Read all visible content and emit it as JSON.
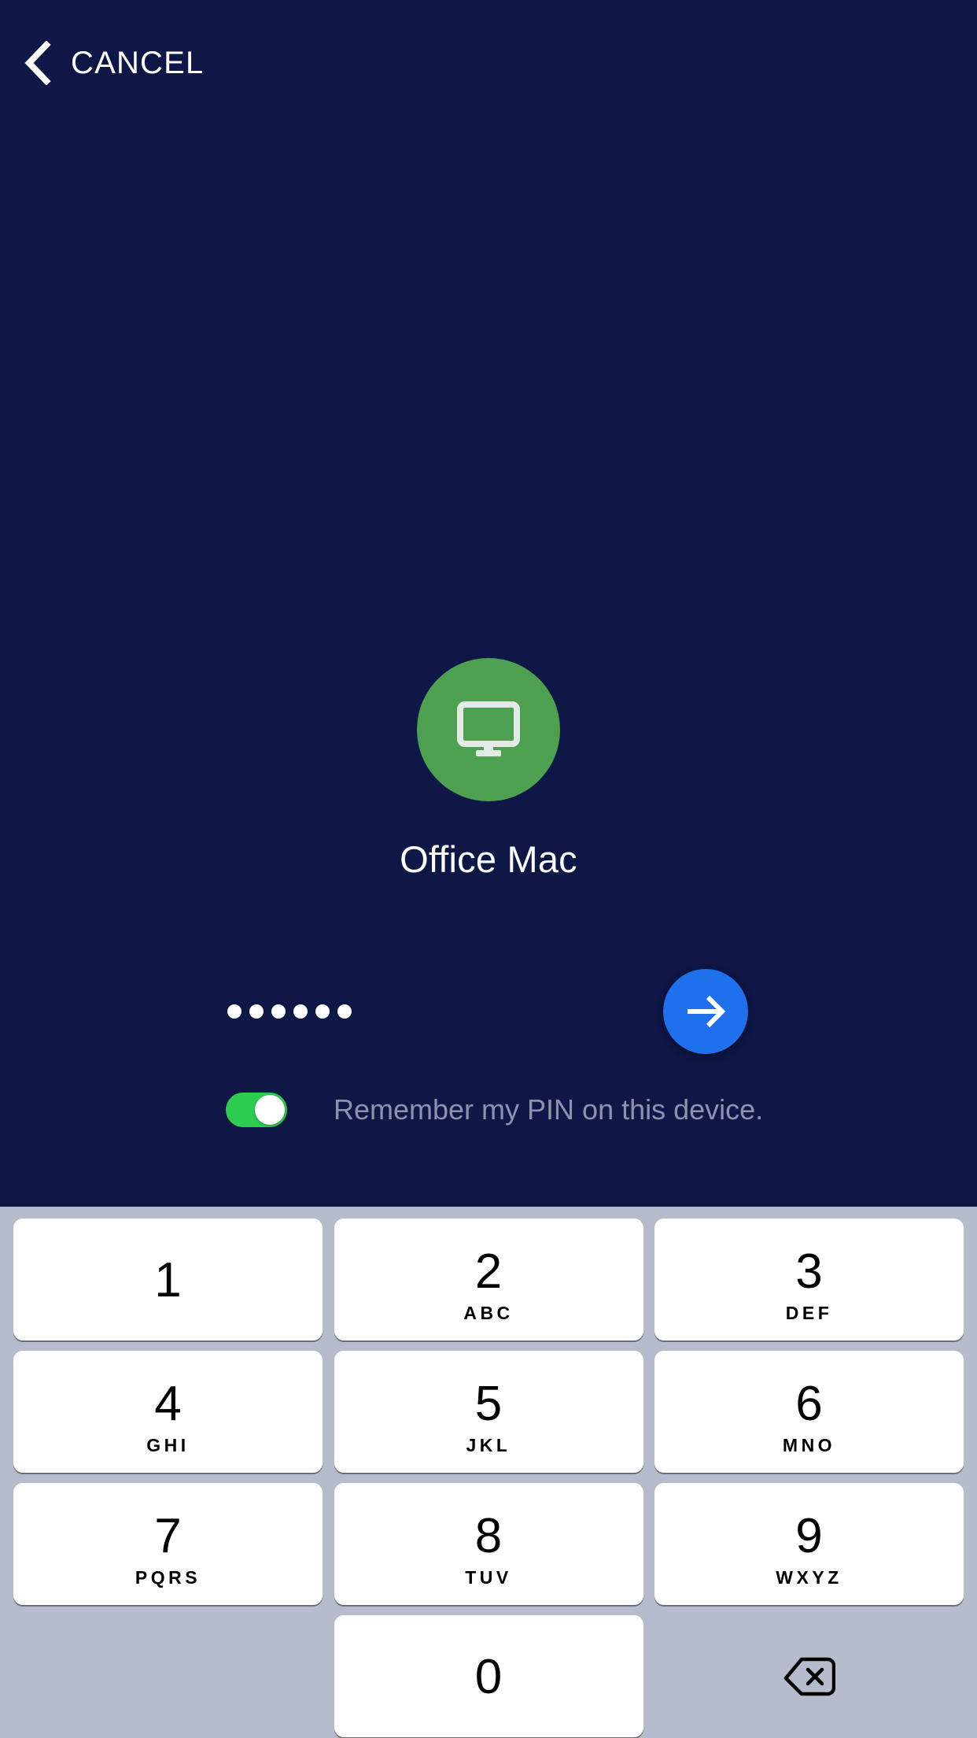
{
  "header": {
    "back_icon": "chevron-left-icon",
    "cancel_label": "CANCEL"
  },
  "device": {
    "avatar_icon": "monitor-icon",
    "avatar_color": "#4CA050",
    "name": "Office Mac"
  },
  "pin_entry": {
    "dots_filled": 6,
    "dot_color": "#FFFFFF",
    "submit_icon": "arrow-right-icon",
    "submit_color": "#1F70EC"
  },
  "remember": {
    "toggle_state": "on",
    "toggle_on_color": "#2ECC50",
    "label": "Remember my PIN on this device."
  },
  "keypad": {
    "background_color": "#B6BCCB",
    "rows": [
      [
        {
          "digit": "1",
          "letters": ""
        },
        {
          "digit": "2",
          "letters": "ABC"
        },
        {
          "digit": "3",
          "letters": "DEF"
        }
      ],
      [
        {
          "digit": "4",
          "letters": "GHI"
        },
        {
          "digit": "5",
          "letters": "JKL"
        },
        {
          "digit": "6",
          "letters": "MNO"
        }
      ],
      [
        {
          "digit": "7",
          "letters": "PQRS"
        },
        {
          "digit": "8",
          "letters": "TUV"
        },
        {
          "digit": "9",
          "letters": "WXYZ"
        }
      ]
    ],
    "zero_key": {
      "digit": "0",
      "letters": ""
    },
    "backspace_icon": "backspace-icon"
  },
  "colors": {
    "background": "#0E1745",
    "text_primary": "#FFFFFF",
    "text_muted": "#8D93AE"
  }
}
